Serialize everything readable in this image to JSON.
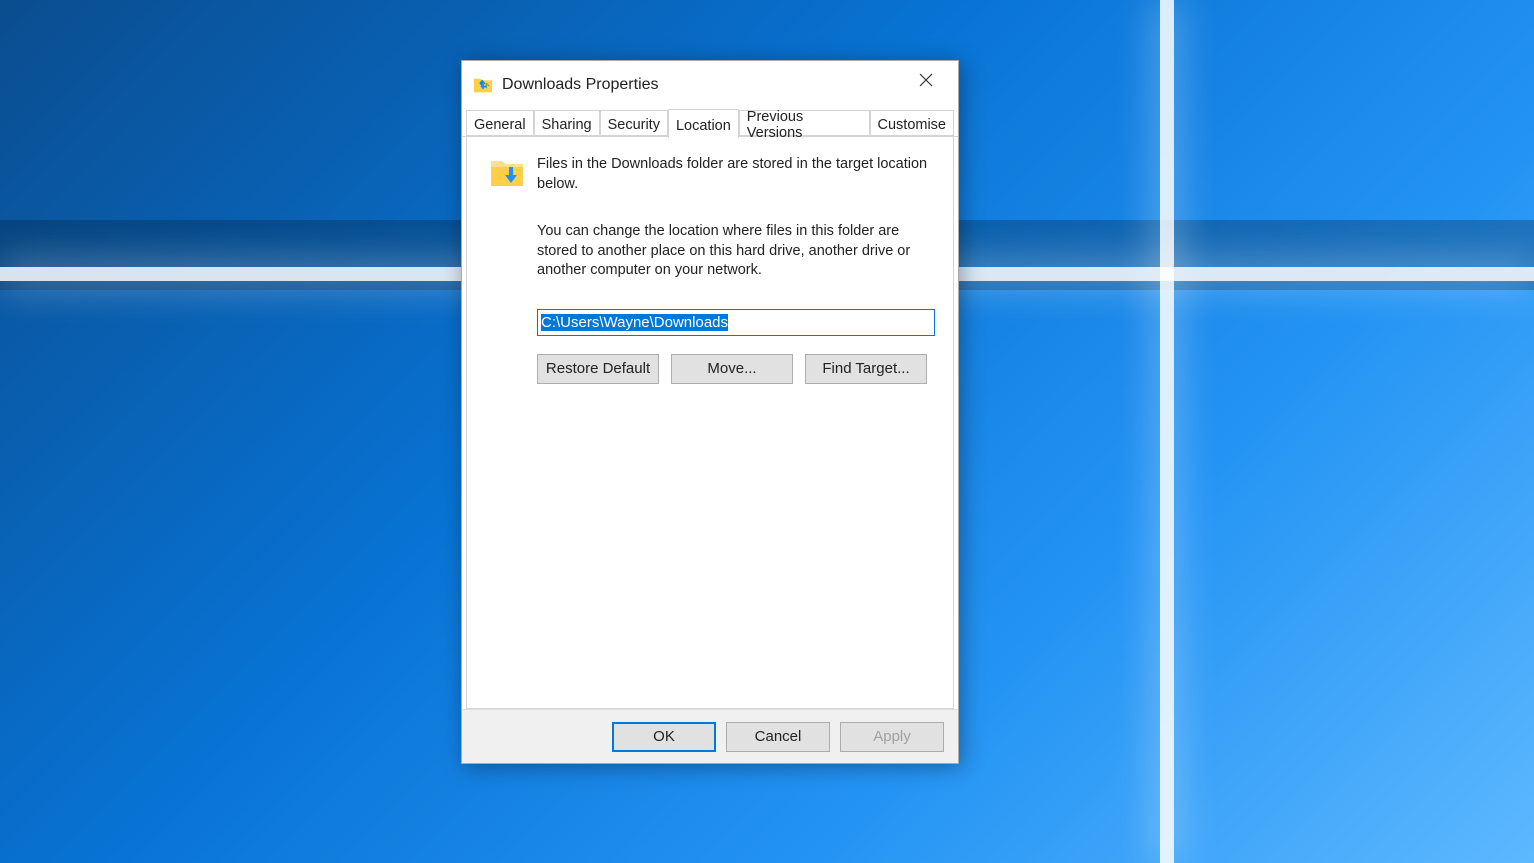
{
  "dialog": {
    "title": "Downloads Properties",
    "tabs": {
      "general": "General",
      "sharing": "Sharing",
      "security": "Security",
      "location": "Location",
      "previous": "Previous Versions",
      "customise": "Customise"
    },
    "location": {
      "intro1": "Files in the Downloads folder are stored in the target location below.",
      "intro2": "You can change the location where files in this folder are stored to another place on this hard drive, another drive or another computer on your network.",
      "path": "C:\\Users\\Wayne\\Downloads",
      "buttons": {
        "restore": "Restore Default",
        "move": "Move...",
        "find": "Find Target..."
      }
    },
    "actions": {
      "ok": "OK",
      "cancel": "Cancel",
      "apply": "Apply"
    }
  }
}
